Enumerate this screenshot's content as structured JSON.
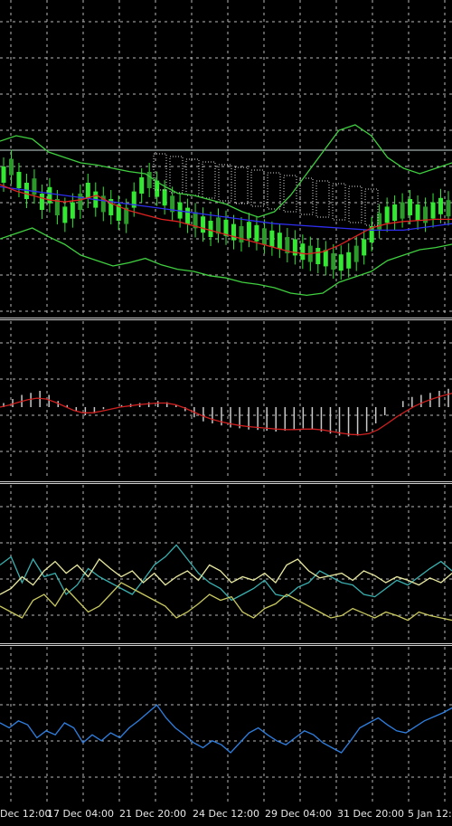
{
  "chart_data": {
    "type": "line",
    "background": "#000000",
    "grid": true,
    "grid_color": "#b8b8b8",
    "x_tick_labels": [
      "Dec 12:00",
      "17 Dec 04:00",
      "21 Dec 20:00",
      "24 Dec 12:00",
      "29 Dec 04:00",
      "31 Dec 20:00",
      "5 Jan 12:"
    ],
    "panels": [
      {
        "name": "price",
        "colors": {
          "bull_candle": "#33e733",
          "bear_candle": "#2b9a2b",
          "bollinger": "#3fcf3f",
          "ma_blue": "#2e2ef0",
          "ma_red": "#e02020",
          "ma_orange": "#d07a3a",
          "ichimoku_cloud": "#dcdcdc",
          "horizontal_level": "#c8d8d8"
        },
        "horizontal_level": 1.0,
        "series": [
          {
            "kind": "candles",
            "values": [
              0.85,
              0.92,
              0.8,
              0.7,
              0.74,
              0.6,
              0.66,
              0.55,
              0.48,
              0.52,
              0.6,
              0.7,
              0.62,
              0.58,
              0.55,
              0.5,
              0.47,
              0.62,
              0.75,
              0.8,
              0.72,
              0.64,
              0.58,
              0.52,
              0.47,
              0.43,
              0.39,
              0.35,
              0.38,
              0.36,
              0.32,
              0.3,
              0.34,
              0.31,
              0.28,
              0.26,
              0.24,
              0.2,
              0.18,
              0.14,
              0.12,
              0.1,
              0.08,
              0.05,
              0.04,
              0.06,
              0.12,
              0.18,
              0.3,
              0.42,
              0.48,
              0.5,
              0.52,
              0.55,
              0.5,
              0.48,
              0.52,
              0.56,
              0.54
            ]
          },
          {
            "kind": "line",
            "color": "#2e2ef0",
            "values": [
              0.78,
              0.76,
              0.74,
              0.72,
              0.7,
              0.68,
              0.66,
              0.64,
              0.62,
              0.6,
              0.58,
              0.56,
              0.54,
              0.52,
              0.5,
              0.48,
              0.46,
              0.44,
              0.43,
              0.42,
              0.41,
              0.4,
              0.39,
              0.38,
              0.38,
              0.38,
              0.4,
              0.42,
              0.44
            ]
          },
          {
            "kind": "line",
            "color": "#e02020",
            "values": [
              0.8,
              0.74,
              0.7,
              0.66,
              0.64,
              0.66,
              0.7,
              0.62,
              0.56,
              0.52,
              0.48,
              0.46,
              0.42,
              0.38,
              0.34,
              0.3,
              0.26,
              0.22,
              0.18,
              0.16,
              0.18,
              0.24,
              0.32,
              0.4,
              0.44,
              0.46,
              0.47,
              0.48,
              0.48
            ]
          },
          {
            "kind": "line",
            "color": "#3fcf3f",
            "values": [
              1.2,
              1.25,
              1.22,
              1.1,
              1.05,
              1.0,
              0.98,
              0.95,
              0.92,
              0.9,
              0.8,
              0.72,
              0.7,
              0.66,
              0.62,
              0.55,
              0.5,
              0.55,
              0.7,
              0.9,
              1.1,
              1.3,
              1.35,
              1.25,
              1.05,
              0.95,
              0.9,
              0.95,
              1.0
            ]
          },
          {
            "kind": "line",
            "color": "#3fcf3f",
            "values": [
              0.3,
              0.35,
              0.4,
              0.32,
              0.25,
              0.15,
              0.1,
              0.05,
              0.08,
              0.12,
              0.06,
              0.02,
              0.0,
              -0.04,
              -0.06,
              -0.1,
              -0.12,
              -0.15,
              -0.2,
              -0.22,
              -0.2,
              -0.1,
              -0.05,
              0.0,
              0.1,
              0.15,
              0.2,
              0.22,
              0.25
            ]
          }
        ]
      },
      {
        "name": "macd",
        "colors": {
          "histogram": "#c8c8c8",
          "signal": "#d02020"
        },
        "series": [
          {
            "kind": "histogram",
            "values": [
              0.1,
              0.2,
              0.3,
              0.35,
              0.4,
              0.3,
              0.15,
              0.05,
              -0.1,
              -0.2,
              -0.15,
              -0.05,
              0.0,
              0.05,
              0.08,
              0.1,
              0.12,
              0.15,
              0.12,
              0.05,
              -0.1,
              -0.25,
              -0.35,
              -0.4,
              -0.45,
              -0.5,
              -0.52,
              -0.55,
              -0.56,
              -0.58,
              -0.6,
              -0.58,
              -0.55,
              -0.52,
              -0.55,
              -0.6,
              -0.65,
              -0.7,
              -0.72,
              -0.7,
              -0.6,
              -0.4,
              -0.2,
              0.0,
              0.15,
              0.25,
              0.3,
              0.35,
              0.4,
              0.45
            ]
          },
          {
            "kind": "line",
            "color": "#d02020",
            "values": [
              0.0,
              0.05,
              0.12,
              0.18,
              0.22,
              0.2,
              0.12,
              0.02,
              -0.08,
              -0.14,
              -0.14,
              -0.1,
              -0.05,
              0.0,
              0.03,
              0.06,
              0.08,
              0.1,
              0.1,
              0.06,
              -0.02,
              -0.12,
              -0.22,
              -0.3,
              -0.36,
              -0.41,
              -0.45,
              -0.48,
              -0.5,
              -0.52,
              -0.54,
              -0.55,
              -0.55,
              -0.54,
              -0.54,
              -0.56,
              -0.6,
              -0.64,
              -0.67,
              -0.68,
              -0.65,
              -0.55,
              -0.4,
              -0.24,
              -0.1,
              0.03,
              0.13,
              0.21,
              0.28,
              0.34
            ]
          }
        ]
      },
      {
        "name": "dmi",
        "colors": {
          "main": "#3ab0b0",
          "plus": "#e8e8a0",
          "minus": "#c8c860"
        },
        "series": [
          {
            "kind": "line",
            "color": "#3ab0b0",
            "values": [
              0.55,
              0.62,
              0.4,
              0.6,
              0.45,
              0.48,
              0.3,
              0.38,
              0.52,
              0.45,
              0.4,
              0.35,
              0.3,
              0.42,
              0.55,
              0.62,
              0.72,
              0.6,
              0.48,
              0.4,
              0.35,
              0.25,
              0.3,
              0.35,
              0.42,
              0.3,
              0.28,
              0.36,
              0.4,
              0.5,
              0.45,
              0.4,
              0.38,
              0.3,
              0.28,
              0.35,
              0.42,
              0.38,
              0.45,
              0.52,
              0.58,
              0.5
            ]
          },
          {
            "kind": "line",
            "color": "#e8e8a0",
            "values": [
              0.3,
              0.35,
              0.45,
              0.38,
              0.5,
              0.58,
              0.48,
              0.55,
              0.45,
              0.6,
              0.52,
              0.45,
              0.5,
              0.4,
              0.48,
              0.38,
              0.45,
              0.5,
              0.42,
              0.55,
              0.5,
              0.4,
              0.45,
              0.42,
              0.48,
              0.4,
              0.55,
              0.6,
              0.5,
              0.44,
              0.46,
              0.48,
              0.42,
              0.5,
              0.46,
              0.4,
              0.45,
              0.42,
              0.38,
              0.44,
              0.4,
              0.48
            ]
          },
          {
            "kind": "line",
            "color": "#c8c860",
            "values": [
              0.2,
              0.15,
              0.1,
              0.25,
              0.3,
              0.2,
              0.35,
              0.25,
              0.15,
              0.2,
              0.3,
              0.4,
              0.35,
              0.3,
              0.25,
              0.2,
              0.1,
              0.15,
              0.22,
              0.3,
              0.25,
              0.28,
              0.15,
              0.1,
              0.18,
              0.22,
              0.3,
              0.25,
              0.2,
              0.15,
              0.1,
              0.12,
              0.18,
              0.14,
              0.1,
              0.15,
              0.12,
              0.08,
              0.15,
              0.12,
              0.1,
              0.08
            ]
          }
        ]
      },
      {
        "name": "oscillator",
        "colors": {
          "line": "#2f7fe0"
        },
        "series": [
          {
            "kind": "line",
            "color": "#2f7fe0",
            "values": [
              0.6,
              0.55,
              0.62,
              0.58,
              0.45,
              0.52,
              0.48,
              0.6,
              0.55,
              0.4,
              0.48,
              0.42,
              0.5,
              0.45,
              0.55,
              0.62,
              0.7,
              0.78,
              0.65,
              0.55,
              0.48,
              0.4,
              0.35,
              0.42,
              0.38,
              0.3,
              0.4,
              0.5,
              0.55,
              0.48,
              0.42,
              0.38,
              0.45,
              0.52,
              0.48,
              0.4,
              0.35,
              0.3,
              0.42,
              0.55,
              0.6,
              0.65,
              0.58,
              0.52,
              0.5,
              0.56,
              0.62,
              0.66,
              0.7,
              0.75
            ]
          }
        ]
      }
    ]
  }
}
